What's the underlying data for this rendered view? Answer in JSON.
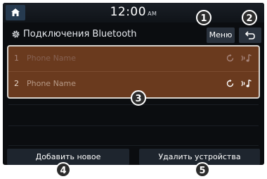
{
  "status_bar": {
    "time": "12:00",
    "ampm": "AM"
  },
  "header": {
    "title": "Подключения Bluetooth",
    "menu_label": "Меню"
  },
  "devices": [
    {
      "index": "1",
      "name": "Phone Name"
    },
    {
      "index": "2",
      "name": "Phone Name"
    }
  ],
  "footer": {
    "add_label": "Добавить новое",
    "delete_label": "Удалить устройства"
  },
  "callouts": [
    "1",
    "2",
    "3",
    "4",
    "5"
  ],
  "colors": {
    "list_bg": "#6a3a1e",
    "panel_bg": "#0b0d10",
    "button_bg": "#1e252e"
  }
}
